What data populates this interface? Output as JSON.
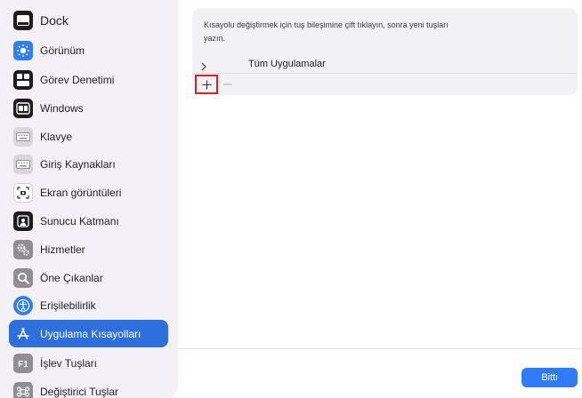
{
  "sidebar": {
    "items": [
      {
        "label": "Dock",
        "icon": "dock-icon"
      },
      {
        "label": "Görünüm",
        "icon": "appearance-icon"
      },
      {
        "label": "Görev Denetimi",
        "icon": "mission-control-icon"
      },
      {
        "label": "Windows",
        "icon": "windows-icon"
      },
      {
        "label": "Klavye",
        "icon": "keyboard-icon"
      },
      {
        "label": "Giriş Kaynakları",
        "icon": "input-sources-icon"
      },
      {
        "label": "Ekran görüntüleri",
        "icon": "screenshot-icon"
      },
      {
        "label": "Sunucu Katmanı",
        "icon": "presenter-overlay-icon"
      },
      {
        "label": "Hizmetler",
        "icon": "services-icon"
      },
      {
        "label": "Öne Çıkanlar",
        "icon": "spotlight-icon"
      },
      {
        "label": "Erişilebilirlik",
        "icon": "accessibility-icon"
      },
      {
        "label": "Uygulama Kısayolları",
        "icon": "app-shortcuts-icon",
        "selected": true
      },
      {
        "label": "İşlev Tuşları",
        "icon": "function-keys-icon"
      },
      {
        "label": "Değiştirici Tuşlar",
        "icon": "modifier-keys-icon"
      }
    ]
  },
  "panel": {
    "description": "Kısayolu değiştirmek için tuş bileşimine çift tıklayın, sonra yeni tuşları yazın.",
    "tree_row_label": "Tüm Uygulamalar",
    "add_label": "+",
    "remove_label": "−"
  },
  "footer": {
    "done_label": "Bitti"
  },
  "colors": {
    "accent": "#2d6fdc",
    "highlight_box": "#e0201e"
  }
}
